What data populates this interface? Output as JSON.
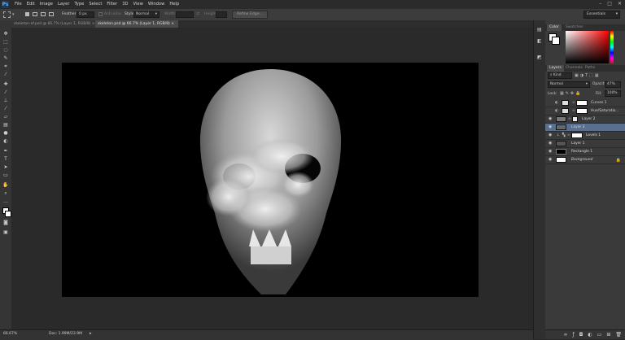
{
  "app": {
    "logo": "Ps"
  },
  "menu": [
    "File",
    "Edit",
    "Image",
    "Layer",
    "Type",
    "Select",
    "Filter",
    "3D",
    "View",
    "Window",
    "Help"
  ],
  "window_controls": [
    "minimize-icon",
    "restore-icon",
    "close-icon"
  ],
  "options": {
    "feather_label": "Feather:",
    "feather_value": "0 px",
    "antialias_label": "Anti-alias",
    "style_label": "Style:",
    "style_value": "Normal",
    "width_label": "Width:",
    "height_label": "Height:",
    "refine_label": "Refine Edge...",
    "workspace": "Essentials"
  },
  "tabs": [
    {
      "label": "skeleton-ef.psd @ 66.7% (Layer 1, RGB/8) ×"
    },
    {
      "label": "skeleton.psd @ 66.7% (Layer 1, RGB/8) ×"
    }
  ],
  "status": {
    "zoom": "66.67%",
    "doc": "Doc: 1.99M/23.9M"
  },
  "panels": {
    "color_tabs": [
      "Color",
      "Swatches"
    ],
    "layers_tabs": [
      "Layers",
      "Channels",
      "Paths"
    ],
    "kind_label": "Kind",
    "blend_mode": "Normal",
    "opacity_label": "Opacity:",
    "opacity_value": "47%",
    "lock_label": "Lock:",
    "fill_label": "Fill:",
    "fill_value": "100%",
    "colors": {
      "accent": "#5a6e8e",
      "hue_red": "#ff0000"
    }
  },
  "layers": [
    {
      "name": "Curves 1",
      "selected": false
    },
    {
      "name": "Hue/Saturatio...",
      "selected": false
    },
    {
      "name": "Layer 2",
      "selected": false
    },
    {
      "name": "Layer 3",
      "selected": true
    },
    {
      "name": "Levels 1",
      "selected": false
    },
    {
      "name": "Layer 1",
      "selected": false
    },
    {
      "name": "Rectangle 1",
      "selected": false
    },
    {
      "name": "Background",
      "selected": false
    }
  ]
}
